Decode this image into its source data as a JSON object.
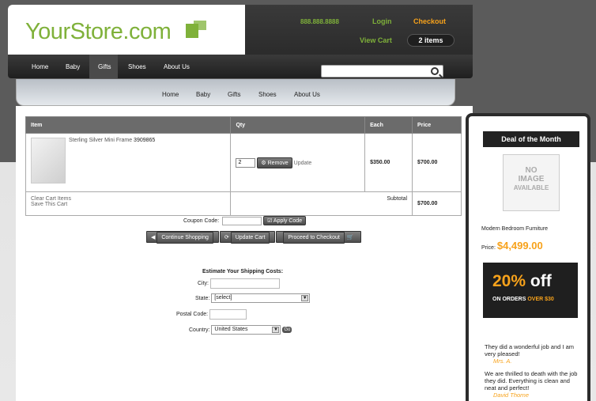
{
  "header": {
    "logo_text": "YourStore.com",
    "phone": "888.888.8888",
    "login": "Login",
    "checkout": "Checkout",
    "view_cart": "View Cart",
    "cart_count": "2 items"
  },
  "nav": {
    "items": [
      "Home",
      "Baby",
      "Gifts",
      "Shoes",
      "About Us"
    ],
    "active": "Gifts"
  },
  "subnav": {
    "items": [
      "Home",
      "Baby",
      "Gifts",
      "Shoes",
      "About Us"
    ]
  },
  "search": {
    "placeholder": "",
    "value": ""
  },
  "cart": {
    "headers": [
      "Item",
      "Qty",
      "Each",
      "Price"
    ],
    "item": {
      "name": "Sterling Silver Mini Frame",
      "sku": "3909865",
      "qty": "2",
      "remove_label": "Remove",
      "update_label": "Update",
      "each": "$350.00",
      "price": "$700.00"
    },
    "clear_link": "Clear Cart Items",
    "save_link": "Save This Cart",
    "subtotal_label": "Subtotal",
    "subtotal": "$700.00"
  },
  "coupon": {
    "label": "Coupon Code:",
    "value": "",
    "apply_label": "Apply Code"
  },
  "actions": {
    "continue": "Continue Shopping",
    "update": "Update Cart",
    "checkout": "Proceed to Checkout"
  },
  "shipping": {
    "title": "Estimate Your Shipping Costs:",
    "city_label": "City:",
    "state_label": "State:",
    "state_value": "[select]",
    "postal_label": "Postal Code:",
    "country_label": "Country:",
    "country_value": "United States",
    "go_label": "Go"
  },
  "sidebar": {
    "deal_title": "Deal of the Month",
    "no_image_lines": [
      "NO",
      "IMAGE",
      "AVAILABLE"
    ],
    "product_name": "Modern Bedroom Furniture",
    "price_label": "Price:",
    "price": "$4,499.00",
    "promo_pct": "20%",
    "promo_off": "off",
    "promo_line_a": "ON ORDERS",
    "promo_line_b": "OVER $30",
    "testimonials": [
      {
        "text": "They did a wonderful job and I am very pleased!",
        "author": "Mrs. A."
      },
      {
        "text": "We are thrilled to death with the job they did. Everything is clean and neat and perfect!",
        "author": "David Thorne"
      }
    ]
  },
  "colors": {
    "brand_green": "#7fb13a",
    "accent_orange": "#f7a21b",
    "dark": "#2b2b2b"
  }
}
